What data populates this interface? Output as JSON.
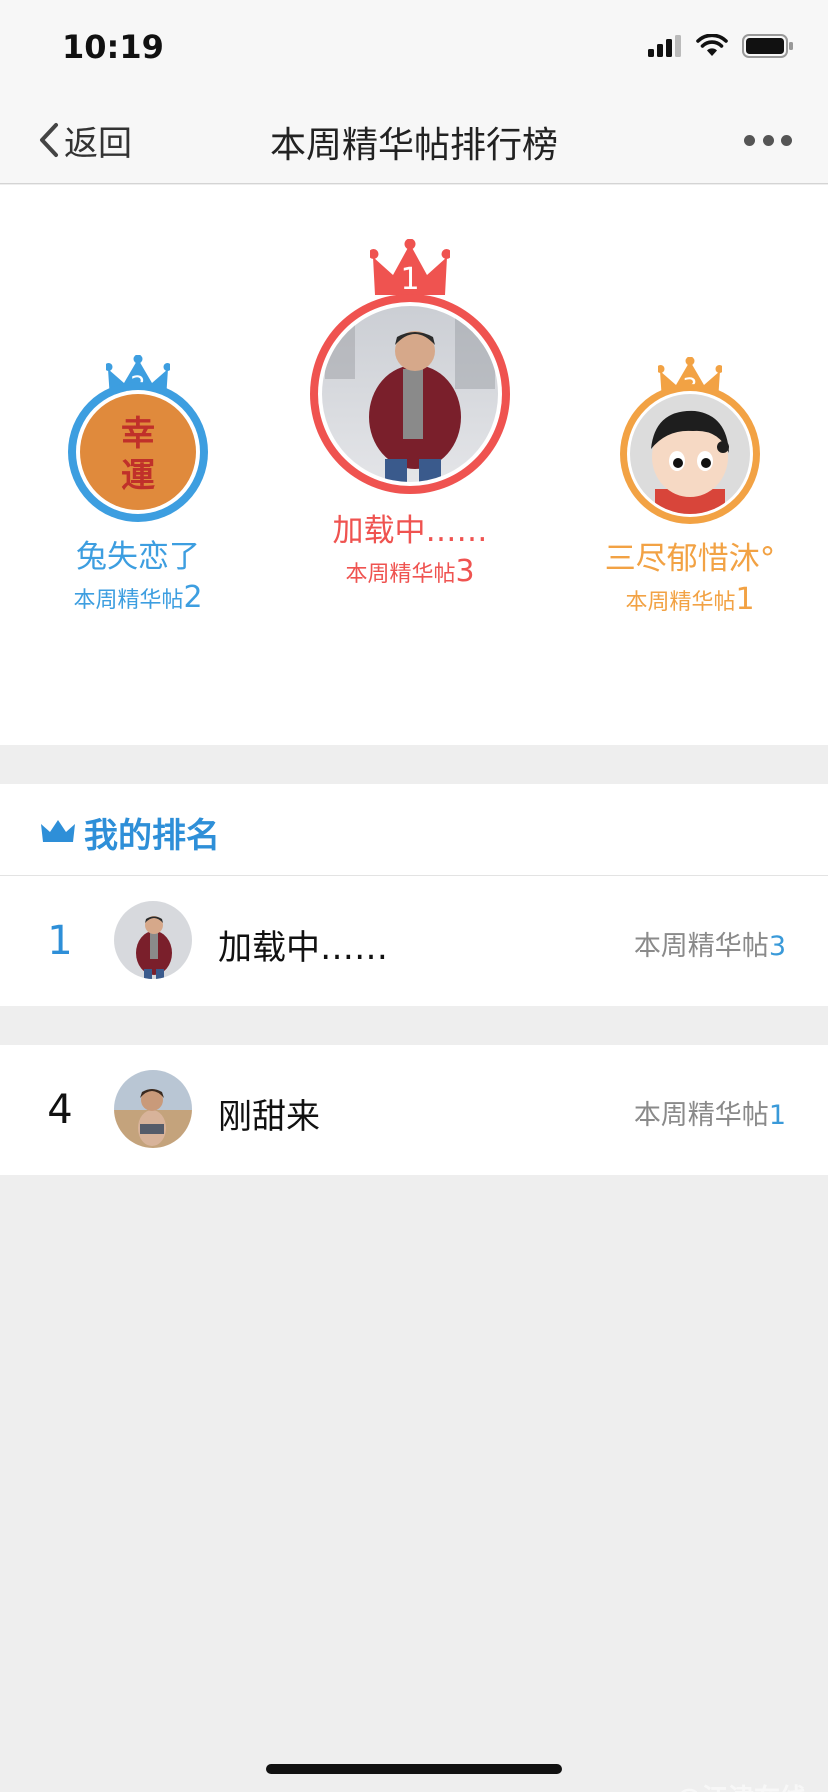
{
  "status_bar": {
    "time": "10:19",
    "icons": [
      "cellular-signal-icon",
      "wifi-icon",
      "battery-icon"
    ]
  },
  "nav": {
    "back_label": "返回",
    "title": "本周精华帖排行榜",
    "more_icon": "more-dots-icon"
  },
  "colors": {
    "rank1": "#ef5350",
    "rank2": "#3d9ee0",
    "rank3": "#f2a244",
    "accent_blue": "#2e8fd8",
    "stat_gray": "#8a8a8a"
  },
  "podium": {
    "first": {
      "rank": "1",
      "name": "加载中……",
      "stat_label": "本周精华帖",
      "stat_value": "3"
    },
    "second": {
      "rank": "2",
      "name": "兔失恋了",
      "stat_label": "本周精华帖",
      "stat_value": "2",
      "avatar_text": "幸運"
    },
    "third": {
      "rank": "3",
      "name": "三尽郁惜沐°",
      "stat_label": "本周精华帖",
      "stat_value": "1"
    }
  },
  "my_rank": {
    "title": "我的排名",
    "rows": [
      {
        "rank": "1",
        "name": "加载中……",
        "stat_label": "本周精华帖",
        "stat_value": "3"
      },
      {
        "rank": "4",
        "name": "刚甜来",
        "stat_label": "本周精华帖",
        "stat_value": "1"
      }
    ]
  },
  "watermark": "@江津在线"
}
